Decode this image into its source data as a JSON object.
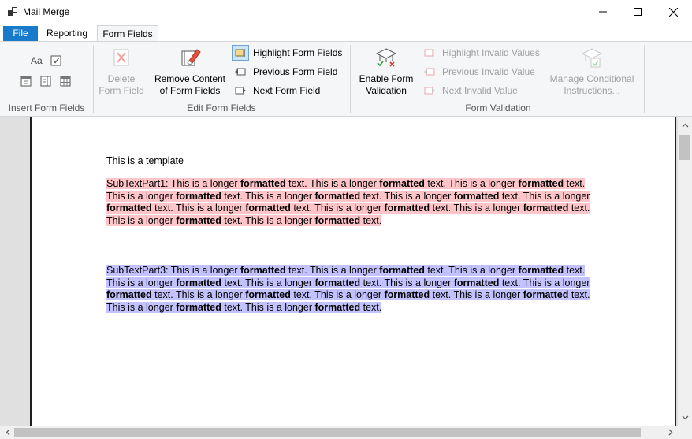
{
  "window": {
    "title": "Mail Merge"
  },
  "tabs": [
    {
      "label": "File"
    },
    {
      "label": "Reporting"
    },
    {
      "label": "Form Fields"
    }
  ],
  "ribbon": {
    "insert_group": {
      "label": "Insert Form Fields",
      "text_field_glyph": "Aa"
    },
    "edit_group": {
      "label": "Edit Form Fields",
      "delete_line1": "Delete",
      "delete_line2": "Form Field",
      "remove_line1": "Remove Content",
      "remove_line2": "of Form Fields",
      "highlight": "Highlight Form Fields",
      "previous": "Previous Form Field",
      "next": "Next Form Field"
    },
    "validation_group": {
      "label": "Form Validation",
      "enable_line1": "Enable Form",
      "enable_line2": "Validation",
      "highlight_invalid": "Highlight Invalid Values",
      "previous_invalid": "Previous Invalid Value",
      "next_invalid": "Next Invalid Value",
      "manage_line1": "Manage Conditional",
      "manage_line2": "Instructions..."
    }
  },
  "document": {
    "title": "This is a template",
    "part1": {
      "prefix": "SubTextPart1: ",
      "repeat_plain": "This is a longer ",
      "repeat_bold": "formatted",
      "repeat_tail": " text. ",
      "count": 12
    },
    "part3": {
      "prefix": "SubTextPart3: ",
      "repeat_plain": "This is a longer ",
      "repeat_bold": "formatted",
      "repeat_tail": " text. ",
      "count": 12
    }
  },
  "colors": {
    "file_tab": "#1979ca",
    "highlight_red": "#ffc5c8",
    "highlight_blue": "#c2c2ff"
  }
}
